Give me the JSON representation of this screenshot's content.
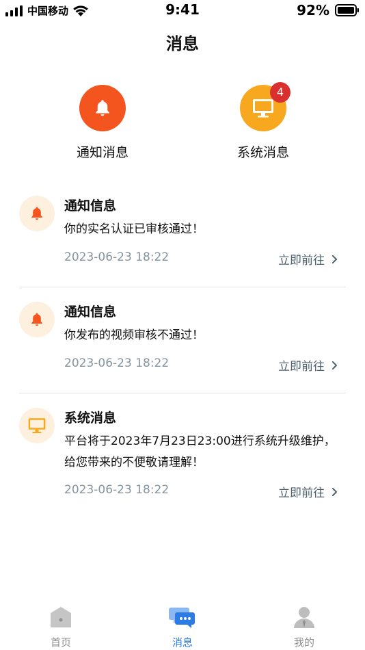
{
  "status_bar": {
    "carrier": "中国移动",
    "time": "9:41",
    "battery": "92%"
  },
  "header": {
    "title": "消息"
  },
  "categories": [
    {
      "label": "通知消息",
      "icon": "bell-icon",
      "color": "#F4541E"
    },
    {
      "label": "系统消息",
      "icon": "monitor-icon",
      "color": "#F8A81E",
      "badge": "4"
    }
  ],
  "messages": [
    {
      "icon": "bell-icon",
      "title": "通知信息",
      "body": "你的实名认证已审核通过！",
      "time": "2023-06-23 18:22",
      "link": "立即前往"
    },
    {
      "icon": "bell-icon",
      "title": "通知信息",
      "body": "你发布的视频审核不通过！",
      "time": "2023-06-23 18:22",
      "link": "立即前往"
    },
    {
      "icon": "monitor-icon",
      "title": "系统消息",
      "body": "平台将于2023年7月23日23:00进行系统升级维护，给您带来的不便敬请理解！",
      "time": "2023-06-23 18:22",
      "link": "立即前往"
    }
  ],
  "tabbar": {
    "items": [
      {
        "label": "首页",
        "icon": "home-icon",
        "active": false
      },
      {
        "label": "消息",
        "icon": "chat-icon",
        "active": true
      },
      {
        "label": "我的",
        "icon": "user-icon",
        "active": false
      }
    ]
  },
  "colors": {
    "accent": "#2D7BE5",
    "notify_orange": "#F4541E",
    "system_yellow": "#F8A81E",
    "badge_red": "#D92F2F",
    "time_gray": "#8595A0"
  }
}
